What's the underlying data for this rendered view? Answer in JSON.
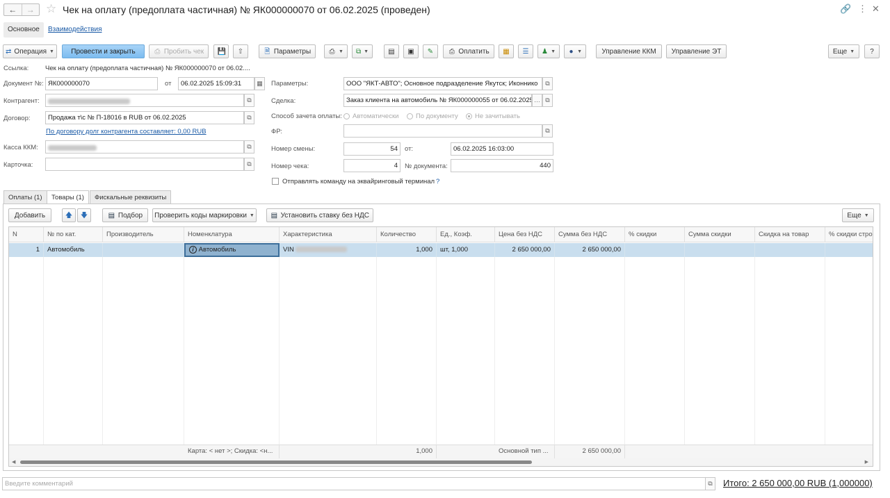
{
  "window": {
    "title": "Чек на оплату (предоплата частичная) № ЯК000000070 от 06.02.2025 (проведен)"
  },
  "top_tabs": {
    "main": "Основное",
    "relations": "Взаимодействия"
  },
  "toolbar": {
    "operation": "Операция",
    "post_close": "Провести и закрыть",
    "punch": "Пробить чек",
    "params": "Параметры",
    "pay": "Оплатить",
    "kkm": "Управление ККМ",
    "et": "Управление ЭТ",
    "more": "Еще",
    "help": "?"
  },
  "form": {
    "link_label": "Ссылка:",
    "link_value": "Чек на оплату (предоплата частичная) № ЯК000000070 от 06.02....",
    "doc_label": "Документ №:",
    "doc_value": "ЯК000000070",
    "from_label": "от",
    "date_value": "06.02.2025 15:09:31",
    "contractor_label": "Контрагент:",
    "contract_label": "Договор:",
    "contract_value": "Продажа т\\с № П-18016 в RUB от 06.02.2025",
    "debt_link": "По договору долг контрагента составляет: 0,00 RUB",
    "kkm_label": "Касса ККМ:",
    "card_label": "Карточка:",
    "params_label": "Параметры:",
    "params_value": "ООО \"ЯКТ-АВТО\"; Основное  подразделение Якутск; Иконнико",
    "deal_label": "Сделка:",
    "deal_value": "Заказ клиента на автомобиль № ЯК000000055 от 06.02.2025",
    "payment_method_label": "Способ зачета оплаты:",
    "radio_auto": "Автоматически",
    "radio_doc": "По документу",
    "radio_none": "Не зачитывать",
    "fr_label": "ФР:",
    "shift_label": "Номер смены:",
    "shift_value": "54",
    "shift_from_label": "от:",
    "shift_date": "06.02.2025 16:03:00",
    "check_no_label": "Номер чека:",
    "check_no_value": "4",
    "doc_no_label": "№ документа:",
    "doc_no_value": "440",
    "acquiring_label": "Отправлять команду на эквайринговый терминал",
    "acquiring_help": "?"
  },
  "lower_tabs": [
    "Оплаты (1)",
    "Товары (1)",
    "Фискальные реквизиты"
  ],
  "goods_toolbar": {
    "add": "Добавить",
    "pick": "Подбор",
    "check_codes": "Проверить коды маркировки",
    "set_vat": "Установить ставку без НДС",
    "more": "Еще"
  },
  "grid": {
    "columns": [
      "N",
      "№ по кат.",
      "Производитель",
      "Номенклатура",
      "Характеристика",
      "Количество",
      "Ед., Коэф.",
      "Цена без НДС",
      "Сумма без НДС",
      "% скидки",
      "Сумма скидки",
      "Скидка на товар",
      "% скидки стро"
    ],
    "rows": [
      {
        "n": "1",
        "cat": "Автомобиль",
        "maker": "",
        "nomen": "Автомобиль",
        "char": "VIN",
        "qty": "1,000",
        "unit": "шт, 1,000",
        "price": "2 650 000,00",
        "sum": "2 650 000,00",
        "disc_pct": "",
        "disc_sum": "",
        "disc_item": "",
        "disc_row": ""
      }
    ],
    "footer": {
      "card": "Карта: < нет >; Скидка: <н...",
      "qty": "1,000",
      "type": "Основной тип ...",
      "sum": "2 650 000,00"
    }
  },
  "bottom": {
    "comment_placeholder": "Введите комментарий",
    "total": "Итого: 2 650 000,00 RUB (1,000000)"
  }
}
